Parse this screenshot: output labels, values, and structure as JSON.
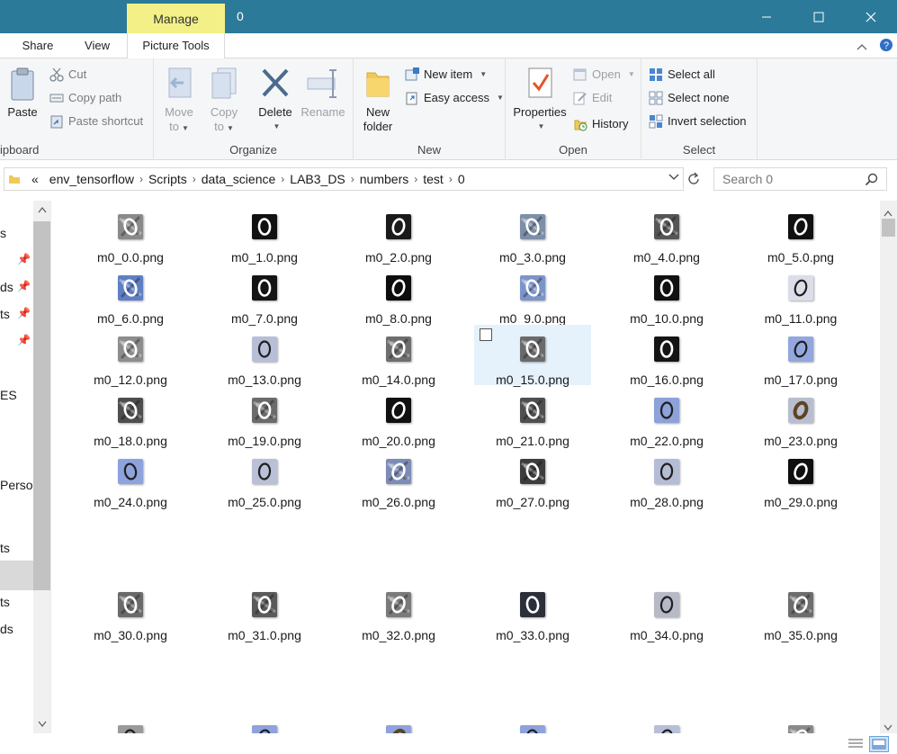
{
  "titlebar": {
    "manage_label": "Manage",
    "title": "0",
    "bg_color": "#2b7a99",
    "accent_color": "#f3f088"
  },
  "tabs": {
    "share": "Share",
    "view": "View",
    "picture_tools": "Picture Tools"
  },
  "ribbon": {
    "clipboard": {
      "label": "ipboard",
      "paste": "Paste",
      "cut": "Cut",
      "copy_path": "Copy path",
      "paste_shortcut": "Paste shortcut"
    },
    "organize": {
      "label": "Organize",
      "move_to_1": "Move",
      "move_to_2": "to",
      "copy_to_1": "Copy",
      "copy_to_2": "to",
      "delete": "Delete",
      "rename": "Rename"
    },
    "new": {
      "label": "New",
      "new_folder_1": "New",
      "new_folder_2": "folder",
      "new_item": "New item",
      "easy_access": "Easy access"
    },
    "open": {
      "label": "Open",
      "properties": "Properties",
      "open": "Open",
      "edit": "Edit",
      "history": "History"
    },
    "select": {
      "label": "Select",
      "select_all": "Select all",
      "select_none": "Select none",
      "invert_selection": "Invert selection"
    }
  },
  "address": {
    "overflow": "«",
    "crumbs": [
      "env_tensorflow",
      "Scripts",
      "data_science",
      "LAB3_DS",
      "numbers",
      "test",
      "0"
    ],
    "search_placeholder": "Search 0"
  },
  "nav": {
    "items": [
      "s",
      "ds",
      "ts",
      "ES",
      "Perso",
      "ts",
      "ts",
      "ds"
    ]
  },
  "files": [
    {
      "name": "m0_0.0.png",
      "bg": "#8a8a8a",
      "style": "noisy"
    },
    {
      "name": "m0_1.0.png",
      "bg": "#111111",
      "style": "dark"
    },
    {
      "name": "m0_2.0.png",
      "bg": "#1a1a1a",
      "style": "dark"
    },
    {
      "name": "m0_3.0.png",
      "bg": "#7d8ea8",
      "style": "noisyblue"
    },
    {
      "name": "m0_4.0.png",
      "bg": "#555555",
      "style": "noisy"
    },
    {
      "name": "m0_5.0.png",
      "bg": "#111111",
      "style": "dark"
    },
    {
      "name": "m0_6.0.png",
      "bg": "#5f7fc4",
      "style": "noisyblue"
    },
    {
      "name": "m0_7.0.png",
      "bg": "#141414",
      "style": "dark"
    },
    {
      "name": "m0_8.0.png",
      "bg": "#0d0d0d",
      "style": "dark"
    },
    {
      "name": "m0_9.0.png",
      "bg": "#7c95c9",
      "style": "noisyblue"
    },
    {
      "name": "m0_10.0.png",
      "bg": "#111111",
      "style": "dark"
    },
    {
      "name": "m0_11.0.png",
      "bg": "#dcdde8",
      "style": "light"
    },
    {
      "name": "m0_12.0.png",
      "bg": "#8d8d8d",
      "style": "noisy"
    },
    {
      "name": "m0_13.0.png",
      "bg": "#b7bfd8",
      "style": "light"
    },
    {
      "name": "m0_14.0.png",
      "bg": "#6e6e6e",
      "style": "noisy"
    },
    {
      "name": "m0_15.0.png",
      "bg": "#6a6a6a",
      "style": "noisy",
      "selected": true
    },
    {
      "name": "m0_16.0.png",
      "bg": "#151515",
      "style": "dark"
    },
    {
      "name": "m0_17.0.png",
      "bg": "#93a6de",
      "style": "light"
    },
    {
      "name": "m0_18.0.png",
      "bg": "#4e4e4e",
      "style": "noisy"
    },
    {
      "name": "m0_19.0.png",
      "bg": "#6b6b6b",
      "style": "noisy"
    },
    {
      "name": "m0_20.0.png",
      "bg": "#101010",
      "style": "dark"
    },
    {
      "name": "m0_21.0.png",
      "bg": "#4f4f4f",
      "style": "noisy"
    },
    {
      "name": "m0_22.0.png",
      "bg": "#8ca2d8",
      "style": "light"
    },
    {
      "name": "m0_23.0.png",
      "bg": "#b8bed0",
      "style": "brown"
    },
    {
      "name": "m0_24.0.png",
      "bg": "#8ea3dd",
      "style": "light"
    },
    {
      "name": "m0_25.0.png",
      "bg": "#b9c0d8",
      "style": "light"
    },
    {
      "name": "m0_26.0.png",
      "bg": "#7d8cb5",
      "style": "noisyblue"
    },
    {
      "name": "m0_27.0.png",
      "bg": "#3d3d3d",
      "style": "noisy"
    },
    {
      "name": "m0_28.0.png",
      "bg": "#b5bdd6",
      "style": "light"
    },
    {
      "name": "m0_29.0.png",
      "bg": "#0f0f0f",
      "style": "dark"
    },
    {
      "name": "m0_30.0.png",
      "bg": "#6a6a6a",
      "style": "noisy"
    },
    {
      "name": "m0_31.0.png",
      "bg": "#5a5a5a",
      "style": "noisy"
    },
    {
      "name": "m0_32.0.png",
      "bg": "#7a7a7a",
      "style": "noisy"
    },
    {
      "name": "m0_33.0.png",
      "bg": "#2b2f3a",
      "style": "dark"
    },
    {
      "name": "m0_34.0.png",
      "bg": "#b7b9c6",
      "style": "light"
    },
    {
      "name": "m0_35.0.png",
      "bg": "#6d6d6d",
      "style": "noisy"
    },
    {
      "name": "",
      "bg": "#9a9a9a",
      "style": "light"
    },
    {
      "name": "",
      "bg": "#8ea3dd",
      "style": "light"
    },
    {
      "name": "",
      "bg": "#8ea3dd",
      "style": "brown"
    },
    {
      "name": "",
      "bg": "#8ea3dd",
      "style": "light"
    },
    {
      "name": "",
      "bg": "#b7bfd8",
      "style": "light"
    },
    {
      "name": "",
      "bg": "#8a8a8a",
      "style": "noisy"
    }
  ]
}
